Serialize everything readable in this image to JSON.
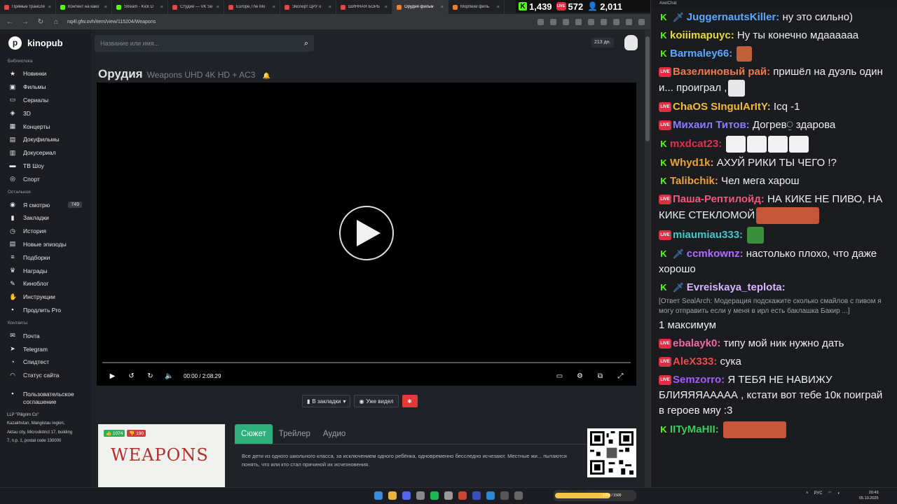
{
  "browser": {
    "tabs": [
      {
        "label": "Прямые трансля",
        "color": "#e24b4b"
      },
      {
        "label": "Контент на како",
        "color": "#53fc18"
      },
      {
        "label": "Stream - Kick D",
        "color": "#53fc18"
      },
      {
        "label": "Студия — VK Se",
        "color": "#e24b4b"
      },
      {
        "label": "Europe,The Mo",
        "color": "#e24b4b"
      },
      {
        "label": "Эксперт ЦРУ о",
        "color": "#e24b4b"
      },
      {
        "label": "ШИННАЯ БОРЬ",
        "color": "#e24b4b"
      },
      {
        "label": "Орудия фильм",
        "color": "#e8823b"
      },
      {
        "label": "Морпехи филь",
        "color": "#e8823b"
      }
    ],
    "url": "nq4l.gfw.ovh/item/view/115204/Weapons"
  },
  "counters": {
    "kick": "1,439",
    "live": "572",
    "viewers": "2,011"
  },
  "site": {
    "logo": "kinopub",
    "search_placeholder": "Название или имя...",
    "days": "213 дн.",
    "sections": {
      "library": "Библиотека",
      "other": "Остальное",
      "contacts": "Контакты"
    },
    "library": [
      "Новинки",
      "Фильмы",
      "Сериалы",
      "3D",
      "Концерты",
      "Докуфильмы",
      "Докусериал",
      "ТВ Шоу",
      "Спорт"
    ],
    "other": [
      "Я смотрю",
      "Закладки",
      "История",
      "Новые эпизоды",
      "Подборки",
      "Награды",
      "Киноблог",
      "Инструкции",
      "Продлить Pro"
    ],
    "watching_count": "749",
    "contacts": [
      "Почта",
      "Telegram",
      "Спидтест",
      "Статус сайта"
    ],
    "agreement": "Пользовательское соглашение",
    "legal": [
      "LLP \"Piligrim Co\"",
      "Kazakhstan, Mangistau region,",
      "Aktau city, Microdistrict 17, building",
      "7, n.p. 1, postal code 130000"
    ]
  },
  "movie": {
    "title_ru": "Орудия",
    "title_en": "Weapons UHD 4K HD + AC3",
    "time_current": "00:00",
    "time_sep": "/",
    "time_total": "2:08:29",
    "bookmark_label": "В закладки",
    "watched_label": "Уже видел",
    "likes": "1074",
    "dislikes": "190",
    "poster_title": "WEAPONS",
    "tabs": [
      "Сюжет",
      "Трейлер",
      "Аудио"
    ],
    "plot": "Все дети из одного школьного класса, за исключением одного ребёнка, одновременно бесследно исчезают. Местные жи... пытаются понять, что или кто стал причиной их исчезновения."
  },
  "chat": {
    "title": "AxelChat",
    "messages": [
      {
        "platform": "kick",
        "mod": true,
        "name": "JuggernautsKiller:",
        "color": "#5aa8ff",
        "text": "ну это сильно)"
      },
      {
        "platform": "kick",
        "mod": false,
        "name": "koiiimapuyc:",
        "color": "#e9d83a",
        "text": "Ну ты конечно мдаааааа"
      },
      {
        "platform": "kick",
        "mod": false,
        "name": "Barmaley66:",
        "color": "#5aa8ff",
        "text": ""
      },
      {
        "platform": "live",
        "mod": false,
        "name": "Вазелиновый рай:",
        "color": "#ef7a4a",
        "text": "пришёл на дуэль один и... проиграл ,"
      },
      {
        "platform": "live",
        "mod": false,
        "name": "ChaOS SIngulArItY:",
        "color": "#f2b93b",
        "text": "Icq -1"
      },
      {
        "platform": "live",
        "mod": false,
        "name": "Михаил Титов:",
        "color": "#8a7bff",
        "text": "Догрев⍜ здарова"
      },
      {
        "platform": "kick",
        "mod": false,
        "name": "mxdcat23:",
        "color": "#e0314f",
        "text": ""
      },
      {
        "platform": "kick",
        "mod": false,
        "name": "Whyd1k:",
        "color": "#e9a23a",
        "text": "АХУЙ РИКИ ТЫ ЧЕГО !?"
      },
      {
        "platform": "kick",
        "mod": false,
        "name": "Talibchik:",
        "color": "#e9a23a",
        "text": "Чел мега харош"
      },
      {
        "platform": "live",
        "mod": false,
        "name": "Паша-Рептилойд:",
        "color": "#ef5a7a",
        "text": "НА КИКЕ НЕ ПИВО, НА КИКЕ СТЕКЛОМОЙ"
      },
      {
        "platform": "live",
        "mod": false,
        "name": "miaumiau333:",
        "color": "#3ec9c9",
        "text": ""
      },
      {
        "platform": "kick",
        "mod": true,
        "name": "ccmkownz:",
        "color": "#b06cff",
        "text": "настолько плохо, что даже хорошо"
      },
      {
        "platform": "kick",
        "mod": true,
        "name": "Evreiskaya_teplota:",
        "color": "#d6b4ff",
        "text": ""
      },
      {
        "platform": "live",
        "mod": false,
        "name": "ebalayk0:",
        "color": "#ef6aa0",
        "text": "типу мой ник нужно дать"
      },
      {
        "platform": "live",
        "mod": false,
        "name": "AleX333:",
        "color": "#ef4a4a",
        "text": "сука"
      },
      {
        "platform": "live",
        "mod": false,
        "name": "Semzorro:",
        "color": "#a45cff",
        "text": "Я ТЕБЯ НЕ НАВИЖУ БЛИЯЯЯААААА , кстати вот тебе 10к поиграй в героев мяу :3"
      },
      {
        "platform": "kick",
        "mod": false,
        "name": "IITyMaHII:",
        "color": "#3ec95a",
        "text": ""
      }
    ],
    "reply_quote": "[Ответ SealArch: Модерация подскажите сколько смайлов с пивом я могу отправить если у меня в ирл есть баклашка Бакир ...]",
    "reply_text": "1 максимум"
  },
  "taskbar": {
    "meme_label": "MEME PARTY",
    "meme_progress": "1000 / 1500",
    "meme_fraction": 0.67,
    "lang": "РУС",
    "time": "20:43",
    "date": "05.10.2025"
  }
}
